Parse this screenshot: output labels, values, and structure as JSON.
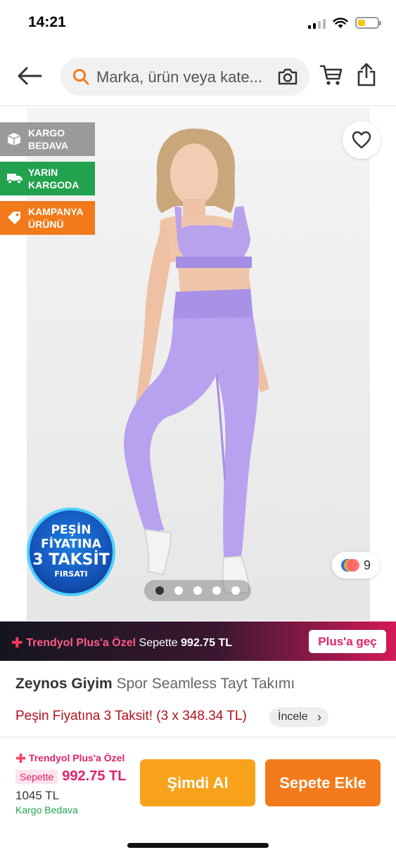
{
  "status_bar": {
    "time": "14:21"
  },
  "search": {
    "placeholder": "Marka, ürün veya kate..."
  },
  "badges": [
    {
      "line1": "KARGO",
      "line2": "BEDAVA",
      "color": "#9a9a9a",
      "icon": "box-icon"
    },
    {
      "line1": "YARIN",
      "line2": "KARGODA",
      "color": "#22a24f",
      "icon": "truck-icon"
    },
    {
      "line1": "KAMPANYA",
      "line2": "ÜRÜNÜ",
      "color": "#f27a1a",
      "icon": "tag-icon"
    }
  ],
  "installment_seal": {
    "line1": "PEŞİN",
    "line2": "FİYATINA",
    "line3": "3 TAKSİT",
    "line4": "FIRSATI"
  },
  "color_options": {
    "count": "9",
    "swatches": [
      "#2f6fe0",
      "#f0b02c",
      "#ff5d6c"
    ]
  },
  "gallery": {
    "total_images": 5,
    "active_index": 0
  },
  "plus_banner": {
    "brand": "Trendyol Plus'a Özel",
    "label": "Sepette",
    "price": "992.75 TL",
    "cta": "Plus'a geç"
  },
  "product": {
    "brand": "Zeynos Giyim",
    "name": "Spor Seamless Tayt Takımı",
    "installment_text": "Peşin Fiyatına 3 Taksit! (3 x 348.34 TL)",
    "inspect_label": "İncele"
  },
  "purchase": {
    "plus_special": "Trendyol Plus'a Özel",
    "cart_tag": "Sepette",
    "cart_price": "992.75 TL",
    "old_price": "1045 TL",
    "shipping": "Kargo Bedava",
    "buy_now": "Şimdi Al",
    "add_to_cart": "Sepete Ekle"
  },
  "colors": {
    "accent": "#f27a1a",
    "plus_pink": "#e2226a",
    "green": "#22a24f",
    "buy_now": "#f8a21b"
  }
}
